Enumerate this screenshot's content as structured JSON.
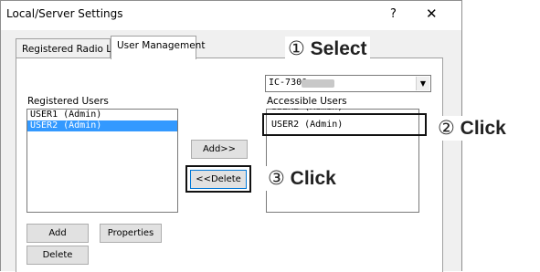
{
  "window": {
    "title": "Local/Server Settings",
    "help_glyph": "?",
    "close_glyph": "✕"
  },
  "tabs": [
    {
      "label": "Registered Radio List",
      "active": false
    },
    {
      "label": "User Management",
      "active": true
    }
  ],
  "model_select": {
    "value": "IC-7300",
    "arrow_glyph": "▼"
  },
  "registered_users": {
    "label": "Registered Users",
    "items": [
      "USER1 (Admin)",
      "USER2 (Admin)"
    ],
    "selected_index": 1
  },
  "accessible_users": {
    "label": "Accessible Users",
    "items": [
      "USER2 (Admin)"
    ]
  },
  "buttons": {
    "add_right": "Add>>",
    "delete_left": "<<Delete",
    "add": "Add",
    "properties": "Properties",
    "delete": "Delete"
  },
  "annotations": {
    "step1_num": "①",
    "step1_text": "Select",
    "step2_num": "②",
    "step2_text": "Click",
    "step3_num": "③",
    "step3_text": "Click"
  }
}
